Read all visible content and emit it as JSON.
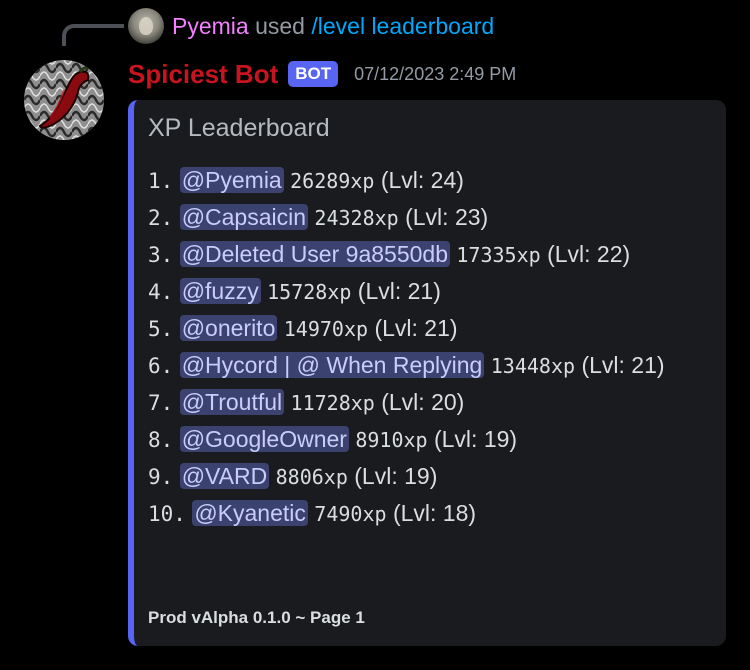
{
  "reply": {
    "username": "Pyemia",
    "used_text": " used ",
    "command": "/level leaderboard"
  },
  "message": {
    "author": "Spiciest Bot",
    "badge": "BOT",
    "timestamp": "07/12/2023 2:49 PM"
  },
  "embed": {
    "accent_color": "#5865f2",
    "title": "XP Leaderboard",
    "entries": [
      {
        "rank": "1.",
        "user": "@Pyemia",
        "xp": "26289xp",
        "level": "(Lvl: 24)"
      },
      {
        "rank": "2.",
        "user": "@Capsaicin",
        "xp": "24328xp",
        "level": "(Lvl: 23)"
      },
      {
        "rank": "3.",
        "user": "@Deleted User 9a8550db",
        "xp": "17335xp",
        "level": "(Lvl: 22)"
      },
      {
        "rank": "4.",
        "user": "@fuzzy",
        "xp": "15728xp",
        "level": "(Lvl: 21)"
      },
      {
        "rank": "5.",
        "user": "@onerito",
        "xp": "14970xp",
        "level": "(Lvl: 21)"
      },
      {
        "rank": "6.",
        "user": "@Hycord | @ When Replying",
        "xp": "13448xp",
        "level": "(Lvl: 21)"
      },
      {
        "rank": "7.",
        "user": "@Troutful",
        "xp": "11728xp",
        "level": "(Lvl: 20)"
      },
      {
        "rank": "8.",
        "user": "@GoogleOwner",
        "xp": "8910xp",
        "level": "(Lvl: 19)"
      },
      {
        "rank": "9.",
        "user": "@VARD",
        "xp": "8806xp",
        "level": "(Lvl: 19)"
      },
      {
        "rank": "10.",
        "user": "@Kyanetic",
        "xp": "7490xp",
        "level": "(Lvl: 18)"
      }
    ],
    "footer": "Prod vAlpha 0.1.0 ~ Page 1"
  },
  "colors": {
    "username_reply": "#f47fff",
    "command": "#00a8fc",
    "bot_name": "#c8141e",
    "mention_bg": "#3c4270",
    "mention_text": "#c9cdfb"
  },
  "icons": {
    "reply_avatar": "user-avatar-icon",
    "bot_avatar": "chili-pepper-avatar-icon"
  }
}
